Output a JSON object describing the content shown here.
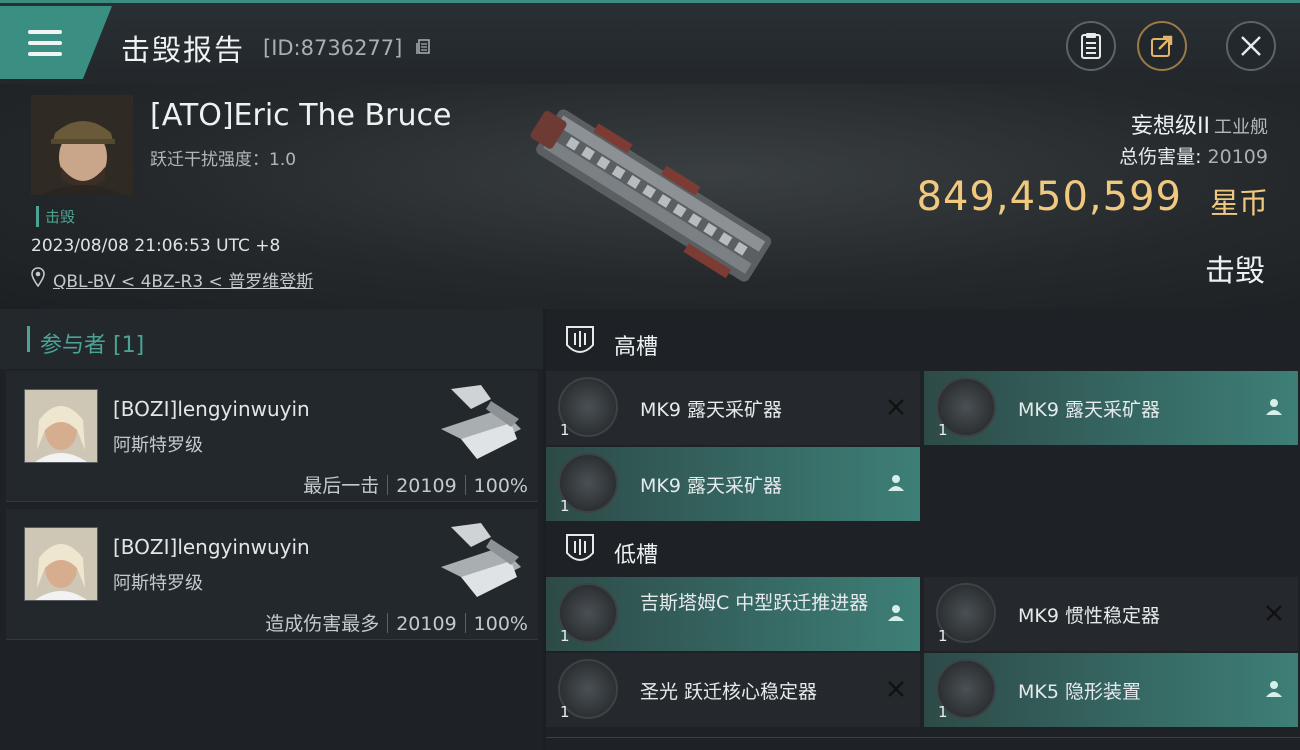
{
  "header": {
    "title": "击毁报告",
    "report_id": "[ID:8736277]",
    "icons": [
      "menu-icon",
      "copy-icon",
      "clipboard-icon",
      "share-icon",
      "close-icon"
    ]
  },
  "victim": {
    "name": "[ATO]Eric The Bruce",
    "warp_disruption": "跃迁干扰强度：1.0",
    "status_tag": "击毁",
    "timestamp": "2023/08/08 21:06:53 UTC +8",
    "location": "QBL-BV < 4BZ-R3 < 普罗维登斯",
    "ship_name": "妄想级II",
    "ship_class": "工业舰",
    "total_damage_label": "总伤害量:",
    "total_damage_value": "20109",
    "isk_value": "849,450,599",
    "isk_unit": "星币",
    "result": "击毁"
  },
  "participants": {
    "title": "参与者 [1]",
    "items": [
      {
        "name": "[BOZI]lengyinwuyin",
        "ship": "阿斯特罗级",
        "label": "最后一击",
        "damage": "20109",
        "percent": "100%"
      },
      {
        "name": "[BOZI]lengyinwuyin",
        "ship": "阿斯特罗级",
        "label": "造成伤害最多",
        "damage": "20109",
        "percent": "100%"
      }
    ]
  },
  "fittings": {
    "high_slot_title": "高槽",
    "low_slot_title": "低槽",
    "high": [
      {
        "name": "MK9 露天采矿器",
        "qty": "1",
        "status": "destroyed"
      },
      {
        "name": "MK9 露天采矿器",
        "qty": "1",
        "status": "dropped"
      },
      {
        "name": "MK9 露天采矿器",
        "qty": "1",
        "status": "dropped"
      }
    ],
    "low": [
      {
        "name": "吉斯塔姆C 中型跃迁推进器",
        "qty": "1",
        "status": "dropped"
      },
      {
        "name": "MK9 惯性稳定器",
        "qty": "1",
        "status": "destroyed"
      },
      {
        "name": "圣光 跃迁核心稳定器",
        "qty": "1",
        "status": "destroyed"
      },
      {
        "name": "MK5 隐形装置",
        "qty": "1",
        "status": "dropped"
      }
    ]
  },
  "colors": {
    "accent": "#3a8f82",
    "isk": "#f0c97f",
    "status_green": "#4ca394"
  }
}
